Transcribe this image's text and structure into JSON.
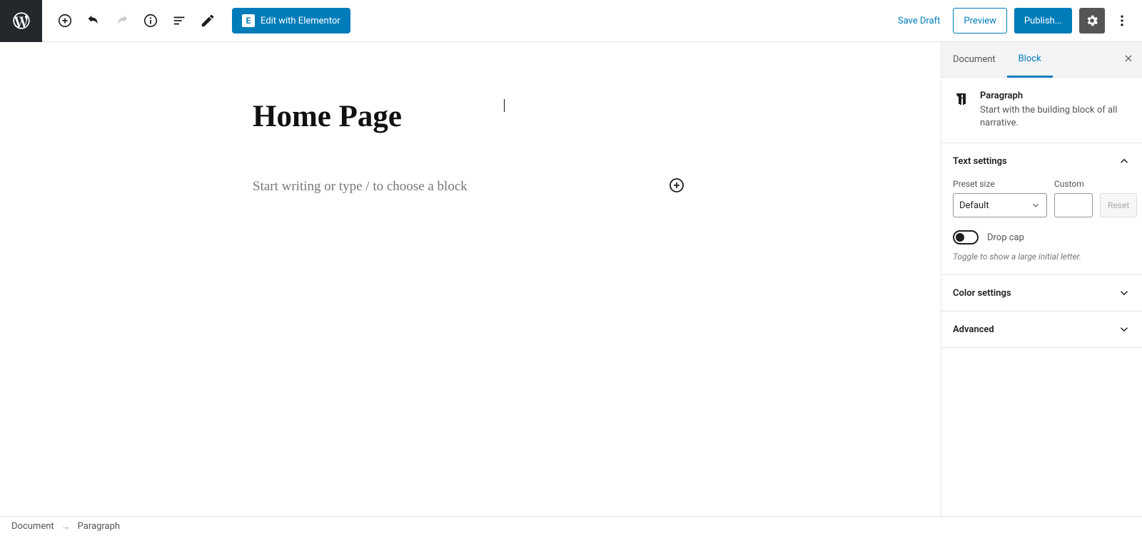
{
  "toolbar": {
    "elementor_label": "Edit with Elementor",
    "save_draft": "Save Draft",
    "preview": "Preview",
    "publish": "Publish..."
  },
  "editor": {
    "title": "Home Page",
    "placeholder": "Start writing or type / to choose a block"
  },
  "sidebar": {
    "tabs": {
      "document": "Document",
      "block": "Block"
    },
    "block_info": {
      "title": "Paragraph",
      "subtitle": "Start with the building block of all narrative."
    },
    "text_settings": {
      "header": "Text settings",
      "preset_label": "Preset size",
      "preset_value": "Default",
      "custom_label": "Custom",
      "reset": "Reset",
      "drop_cap": "Drop cap",
      "drop_cap_help": "Toggle to show a large initial letter."
    },
    "color_settings": "Color settings",
    "advanced": "Advanced"
  },
  "breadcrumb": {
    "root": "Document",
    "current": "Paragraph"
  }
}
